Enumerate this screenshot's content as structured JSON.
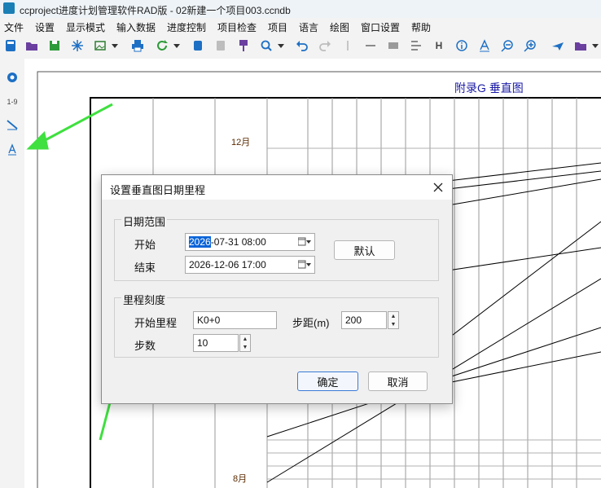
{
  "window": {
    "title": "ccproject进度计划管理软件RAD版 - 02新建一个项目003.ccndb"
  },
  "menu": [
    "文件",
    "设置",
    "显示模式",
    "输入数据",
    "进度控制",
    "项目检查",
    "项目",
    "语言",
    "绘图",
    "窗口设置",
    "帮助"
  ],
  "toolbar": {
    "icons": [
      "new-file-icon",
      "open-folder-icon",
      "save-icon",
      "snowflake-icon",
      "image-icon",
      "dropdown-arrow-icon",
      "print-icon",
      "refresh-icon",
      "dropdown-arrow-icon",
      "copy-icon",
      "paste-icon",
      "brush-icon",
      "search-icon",
      "dropdown-arrow-icon",
      "undo-icon",
      "redo-icon",
      "separator-icon",
      "line-icon",
      "rectangle-icon",
      "align-icon",
      "h-text-icon",
      "info-icon",
      "text-a-icon",
      "zoom-out-icon",
      "zoom-in-icon",
      "plane-icon",
      "folder-icon",
      "dropdown-arrow-icon"
    ],
    "h_label": "H"
  },
  "left_toolbar": {
    "scale_label": "1-9"
  },
  "drawing": {
    "appendix_title": "附录G  垂直图",
    "month_top": "12月",
    "month_bottom": "8月"
  },
  "dialog": {
    "title": "设置垂直图日期里程",
    "date_group": {
      "label": "日期范围",
      "start_label": "开始",
      "start_value_selected": "2026",
      "start_value_rest": "-07-31 08:00",
      "end_label": "结束",
      "end_value": "2026-12-06 17:00",
      "default_button": "默认"
    },
    "mileage_group": {
      "label": "里程刻度",
      "start_label": "开始里程",
      "start_value": "K0+0",
      "step_label": "步距(m)",
      "step_value": "200",
      "count_label": "步数",
      "count_value": "10"
    },
    "ok_button": "确定",
    "cancel_button": "取消"
  },
  "colors": {
    "accent": "#0a64d8",
    "annotation_arrow": "#3fe03f",
    "title_blue": "#1a1aa6"
  }
}
